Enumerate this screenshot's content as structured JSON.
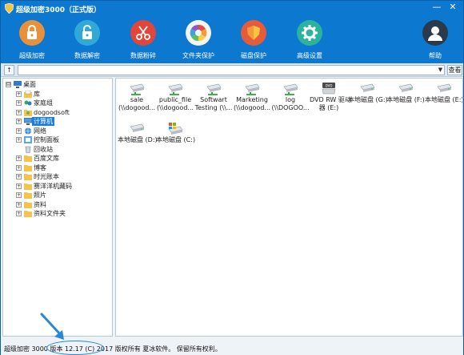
{
  "window": {
    "title": "超级加密3000（正式版）",
    "minimize": "—",
    "close": "✕"
  },
  "toolbar": [
    {
      "label": "超级加密",
      "icon": "lock-icon",
      "color": "#e8913a"
    },
    {
      "label": "数据解密",
      "icon": "unlock-icon",
      "color": "#31a9d8"
    },
    {
      "label": "数据粉碎",
      "icon": "scissors-icon",
      "color": "#e0463b"
    },
    {
      "label": "文件夹保护",
      "icon": "aperture-icon",
      "color": "#f1f1f1"
    },
    {
      "label": "磁盘保护",
      "icon": "shield-icon",
      "color": "#e75b3a"
    },
    {
      "label": "高级设置",
      "icon": "gear-icon",
      "color": "#2bb39d"
    },
    {
      "label": "帮助",
      "icon": "user-icon",
      "color": "#2a3a4a"
    }
  ],
  "address": {
    "up": "↑",
    "value": "",
    "go": "查看"
  },
  "tree": [
    {
      "label": "桌面",
      "level": 0,
      "expander": "⊟",
      "icon": "desktop-icon"
    },
    {
      "label": "库",
      "level": 1,
      "expander": "+",
      "icon": "library-icon"
    },
    {
      "label": "家庭组",
      "level": 1,
      "expander": "+",
      "icon": "homegroup-icon"
    },
    {
      "label": "dogoodsoft",
      "level": 1,
      "expander": "+",
      "icon": "user-folder-icon"
    },
    {
      "label": "计算机",
      "level": 1,
      "expander": "+",
      "icon": "computer-icon",
      "selected": true
    },
    {
      "label": "网络",
      "level": 1,
      "expander": "+",
      "icon": "network-icon"
    },
    {
      "label": "控制面板",
      "level": 1,
      "expander": "+",
      "icon": "control-panel-icon"
    },
    {
      "label": "回收站",
      "level": 1,
      "expander": "",
      "icon": "recycle-bin-icon"
    },
    {
      "label": "百度文库",
      "level": 1,
      "expander": "+",
      "icon": "folder-icon"
    },
    {
      "label": "博客",
      "level": 1,
      "expander": "+",
      "icon": "folder-icon"
    },
    {
      "label": "时光账本",
      "level": 1,
      "expander": "+",
      "icon": "folder-icon"
    },
    {
      "label": "赛洋洋机藏码",
      "level": 1,
      "expander": "+",
      "icon": "folder-icon"
    },
    {
      "label": "照片",
      "level": 1,
      "expander": "+",
      "icon": "folder-icon"
    },
    {
      "label": "资料",
      "level": 1,
      "expander": "+",
      "icon": "folder-icon"
    },
    {
      "label": "资料文件夹",
      "level": 1,
      "expander": "+",
      "icon": "folder-icon"
    }
  ],
  "files": [
    {
      "line1": "sale",
      "line2": "(\\\\dogood...",
      "icon": "network-drive-icon"
    },
    {
      "line1": "public_file",
      "line2": "(\\\\dogood...",
      "icon": "network-drive-icon"
    },
    {
      "line1": "Softwart",
      "line2": "Testing (\\\\...",
      "icon": "network-drive-icon"
    },
    {
      "line1": "Marketing",
      "line2": "(\\\\dogood...",
      "icon": "network-drive-icon"
    },
    {
      "line1": "log",
      "line2": "(\\\\DOGOO...",
      "icon": "network-drive-icon"
    },
    {
      "line1": "DVD RW 驱动",
      "line2": "器 (E:)",
      "icon": "dvd-drive-icon"
    },
    {
      "line1": "本地磁盘 (G:)",
      "line2": "",
      "icon": "hard-disk-icon"
    },
    {
      "line1": "本地磁盘 (F:)",
      "line2": "",
      "icon": "hard-disk-icon"
    },
    {
      "line1": "本地磁盘 (E:)",
      "line2": "",
      "icon": "hard-disk-icon"
    },
    {
      "line1": "本地磁盘 (D:)",
      "line2": "",
      "icon": "hard-disk-icon"
    },
    {
      "line1": "本地磁盘 (C:)",
      "line2": "",
      "icon": "system-disk-icon"
    }
  ],
  "status": {
    "text": "超级加密 3000 版本 12.17 (C) 2017 版权所有 夏冰软件。 保留所有权利。"
  },
  "colors": {
    "accent": "#0c78cf",
    "highlight": "#2a86d8"
  }
}
